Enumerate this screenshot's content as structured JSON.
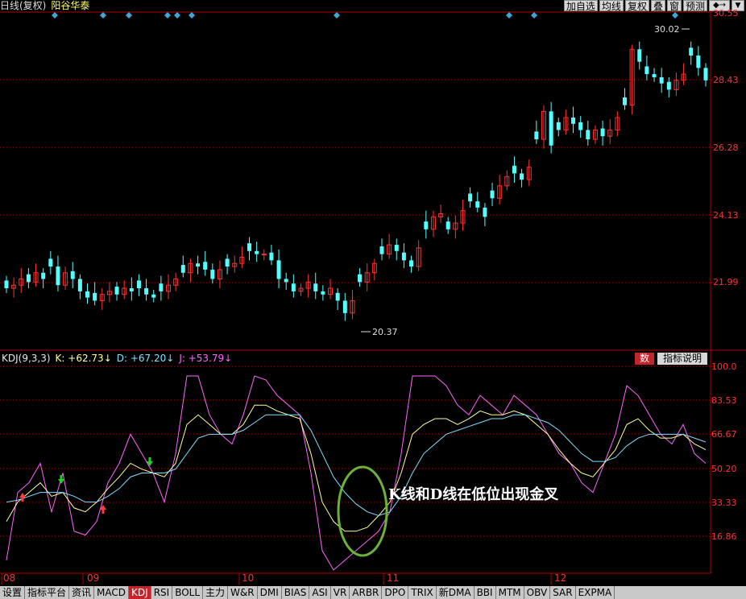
{
  "header": {
    "period": "日线(复权)",
    "stock": "阳谷华泰",
    "buttons": [
      "加自选",
      "均线",
      "复权",
      "叠",
      "窗",
      "预测"
    ],
    "arrow_icon": "◆→",
    "dropdown_icon": "▼"
  },
  "main_chart": {
    "y_labels": [
      "30.55",
      "28.43",
      "26.28",
      "24.13",
      "21.99"
    ],
    "high_label": "30.02",
    "low_label": "20.37",
    "up_color": "#ff3333",
    "down_color": "#54ffff"
  },
  "kdj": {
    "name": "KDJ(9,3,3)",
    "k_text": "K: +62.73",
    "d_text": "D: +67.20",
    "j_text": "J: +53.79",
    "y_labels": [
      "100.0",
      "83.53",
      "66.67",
      "50.20",
      "33.33",
      "16.86"
    ],
    "num_button": "数",
    "explain_button": "指标说明"
  },
  "dates": [
    "08",
    "09",
    "10",
    "11",
    "12"
  ],
  "annotation": "K线和D线在低位出现金叉",
  "tabs": [
    "设置",
    "指标平台",
    "资讯",
    "MACD",
    "KDJ",
    "RSI",
    "BOLL",
    "主力",
    "W&R",
    "DMI",
    "BIAS",
    "ASI",
    "VR",
    "ARBR",
    "DPO",
    "TRIX",
    "新DMA",
    "BBI",
    "MTM",
    "OBV",
    "SAR",
    "EXPMA"
  ],
  "active_tab": "KDJ"
}
